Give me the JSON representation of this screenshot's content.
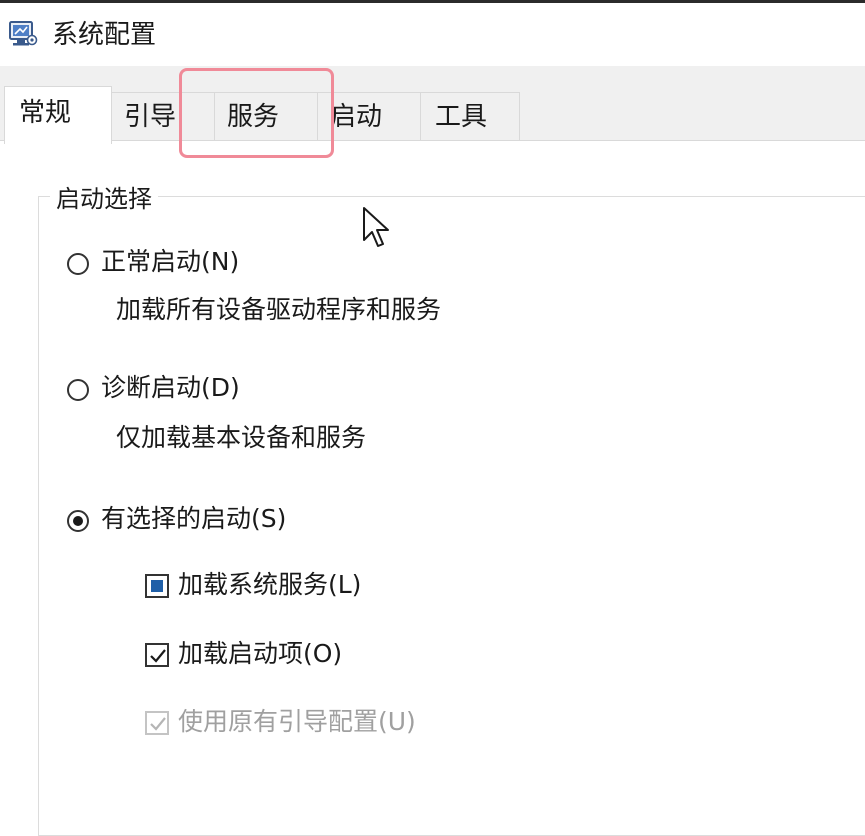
{
  "window": {
    "title": "系统配置",
    "icon": "system-config-icon"
  },
  "tabs": [
    {
      "label": "常规",
      "active": true
    },
    {
      "label": "引导",
      "active": false
    },
    {
      "label": "服务",
      "active": false
    },
    {
      "label": "启动",
      "active": false
    },
    {
      "label": "工具",
      "active": false
    }
  ],
  "startup": {
    "group_title": "启动选择",
    "normal": {
      "label": "正常启动(N)",
      "description": "加载所有设备驱动程序和服务",
      "selected": false
    },
    "diagnostic": {
      "label": "诊断启动(D)",
      "description": "仅加载基本设备和服务",
      "selected": false
    },
    "selective": {
      "label": "有选择的启动(S)",
      "selected": true,
      "options": {
        "load_system_services": {
          "label": "加载系统服务(L)",
          "state": "indeterminate"
        },
        "load_startup_items": {
          "label": "加载启动项(O)",
          "state": "checked"
        },
        "use_original_boot": {
          "label": "使用原有引导配置(U)",
          "state": "checked-disabled"
        }
      }
    }
  },
  "annotation": {
    "highlight_color": "#f08a98"
  },
  "colors": {
    "accent": "#1f5fa8",
    "tab_background": "#f0f0f0",
    "disabled_text": "#a0a0a0"
  }
}
